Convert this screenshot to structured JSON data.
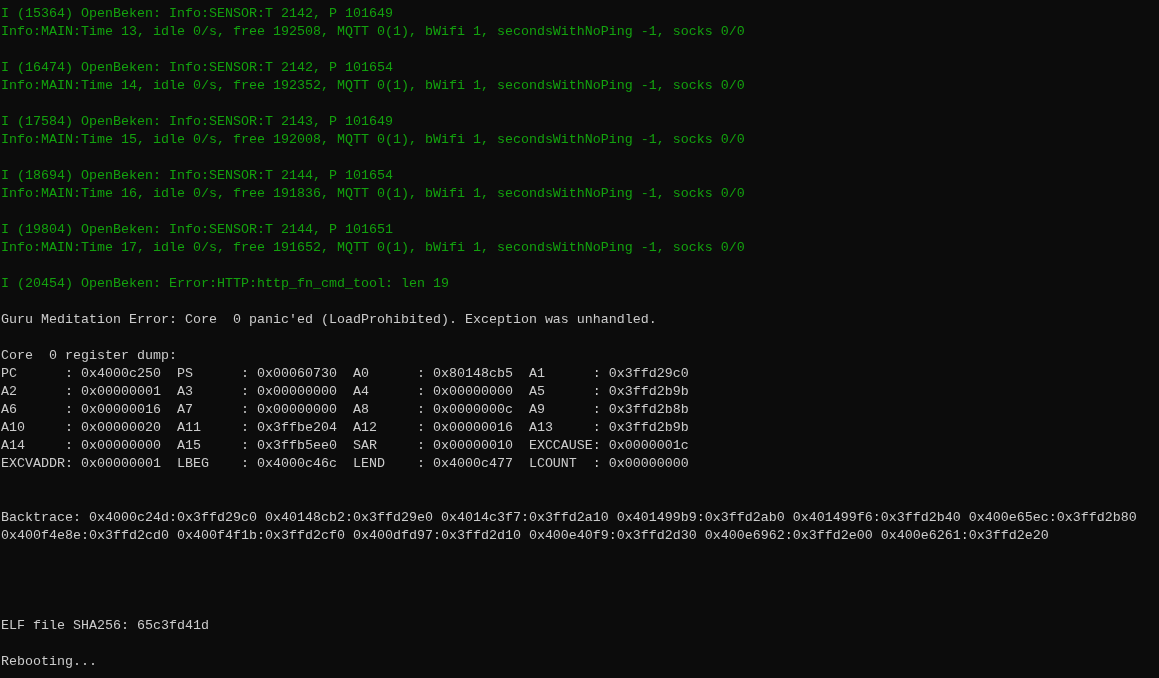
{
  "terminal": {
    "lines": [
      {
        "kind": "log",
        "text": "I (15364) OpenBeken: Info:SENSOR:T 2142, P 101649"
      },
      {
        "kind": "log",
        "text": "Info:MAIN:Time 13, idle 0/s, free 192508, MQTT 0(1), bWifi 1, secondsWithNoPing -1, socks 0/0"
      },
      {
        "kind": "blank"
      },
      {
        "kind": "log",
        "text": "I (16474) OpenBeken: Info:SENSOR:T 2142, P 101654"
      },
      {
        "kind": "log",
        "text": "Info:MAIN:Time 14, idle 0/s, free 192352, MQTT 0(1), bWifi 1, secondsWithNoPing -1, socks 0/0"
      },
      {
        "kind": "blank"
      },
      {
        "kind": "log",
        "text": "I (17584) OpenBeken: Info:SENSOR:T 2143, P 101649"
      },
      {
        "kind": "log",
        "text": "Info:MAIN:Time 15, idle 0/s, free 192008, MQTT 0(1), bWifi 1, secondsWithNoPing -1, socks 0/0"
      },
      {
        "kind": "blank"
      },
      {
        "kind": "log",
        "text": "I (18694) OpenBeken: Info:SENSOR:T 2144, P 101654"
      },
      {
        "kind": "log",
        "text": "Info:MAIN:Time 16, idle 0/s, free 191836, MQTT 0(1), bWifi 1, secondsWithNoPing -1, socks 0/0"
      },
      {
        "kind": "blank"
      },
      {
        "kind": "log",
        "text": "I (19804) OpenBeken: Info:SENSOR:T 2144, P 101651"
      },
      {
        "kind": "log",
        "text": "Info:MAIN:Time 17, idle 0/s, free 191652, MQTT 0(1), bWifi 1, secondsWithNoPing -1, socks 0/0"
      },
      {
        "kind": "blank"
      },
      {
        "kind": "log",
        "text": "I (20454) OpenBeken: Error:HTTP:http_fn_cmd_tool: len 19"
      },
      {
        "kind": "blank"
      },
      {
        "kind": "plain",
        "text": "Guru Meditation Error: Core  0 panic'ed (LoadProhibited). Exception was unhandled."
      },
      {
        "kind": "blank"
      },
      {
        "kind": "plain",
        "text": "Core  0 register dump:"
      },
      {
        "kind": "plain",
        "text": "PC      : 0x4000c250  PS      : 0x00060730  A0      : 0x80148cb5  A1      : 0x3ffd29c0"
      },
      {
        "kind": "plain",
        "text": "A2      : 0x00000001  A3      : 0x00000000  A4      : 0x00000000  A5      : 0x3ffd2b9b"
      },
      {
        "kind": "plain",
        "text": "A6      : 0x00000016  A7      : 0x00000000  A8      : 0x0000000c  A9      : 0x3ffd2b8b"
      },
      {
        "kind": "plain",
        "text": "A10     : 0x00000020  A11     : 0x3ffbe204  A12     : 0x00000016  A13     : 0x3ffd2b9b"
      },
      {
        "kind": "plain",
        "text": "A14     : 0x00000000  A15     : 0x3ffb5ee0  SAR     : 0x00000010  EXCCAUSE: 0x0000001c"
      },
      {
        "kind": "plain",
        "text": "EXCVADDR: 0x00000001  LBEG    : 0x4000c46c  LEND    : 0x4000c477  LCOUNT  : 0x00000000"
      },
      {
        "kind": "blank"
      },
      {
        "kind": "blank"
      },
      {
        "kind": "plain",
        "text": "Backtrace: 0x4000c24d:0x3ffd29c0 0x40148cb2:0x3ffd29e0 0x4014c3f7:0x3ffd2a10 0x401499b9:0x3ffd2ab0 0x401499f6:0x3ffd2b40 0x400e65ec:0x3ffd2b80"
      },
      {
        "kind": "plain",
        "text": "0x400f4e8e:0x3ffd2cd0 0x400f4f1b:0x3ffd2cf0 0x400dfd97:0x3ffd2d10 0x400e40f9:0x3ffd2d30 0x400e6962:0x3ffd2e00 0x400e6261:0x3ffd2e20"
      },
      {
        "kind": "blank"
      },
      {
        "kind": "blank"
      },
      {
        "kind": "blank"
      },
      {
        "kind": "blank"
      },
      {
        "kind": "plain",
        "text": "ELF file SHA256: 65c3fd41d"
      },
      {
        "kind": "blank"
      },
      {
        "kind": "plain",
        "text": "Rebooting..."
      }
    ]
  }
}
